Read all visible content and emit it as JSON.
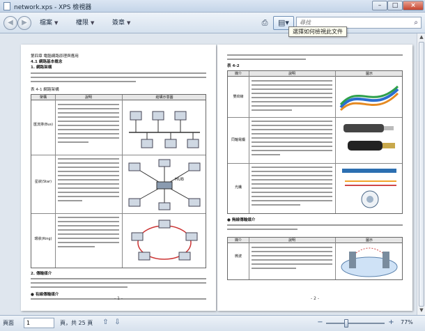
{
  "window": {
    "title": "network.xps - XPS 檢視器"
  },
  "toolbar": {
    "menu_file": "檔案",
    "menu_permissions": "權限",
    "menu_signatures": "簽章",
    "search_placeholder": "尋找",
    "tooltip": "選擇如何檢視此文件"
  },
  "page1": {
    "lines": [
      "第四章  電腦網路原理與應用",
      "4.1 網路基本概念",
      "1. 網路架構",
      "表 4-1  網路架構",
      "2. 傳輸媒介",
      "● 有線傳輸媒介"
    ],
    "table_headers": [
      "架構",
      "說明",
      "結構示意圖"
    ],
    "table_rows": [
      "匯流排(Bus)",
      "星狀(Star)",
      "環狀(Ring)"
    ],
    "hub_label": "HUB",
    "page_number": "- 1 -"
  },
  "page2": {
    "lines": [
      "表 4-2",
      "● 無線傳輸媒介"
    ],
    "table_headers": [
      "媒介",
      "說明",
      "圖示"
    ],
    "table_rows": [
      "雙絞線",
      "同軸電纜",
      "光纖"
    ],
    "table2_headers": [
      "媒介",
      "說明",
      "圖示"
    ],
    "table2_rows": [
      "微波"
    ],
    "page_number": "- 2 -"
  },
  "statusbar": {
    "page_label": "頁面",
    "page_value": "1",
    "total_label": "頁，共 25 頁",
    "zoom": "77%"
  }
}
